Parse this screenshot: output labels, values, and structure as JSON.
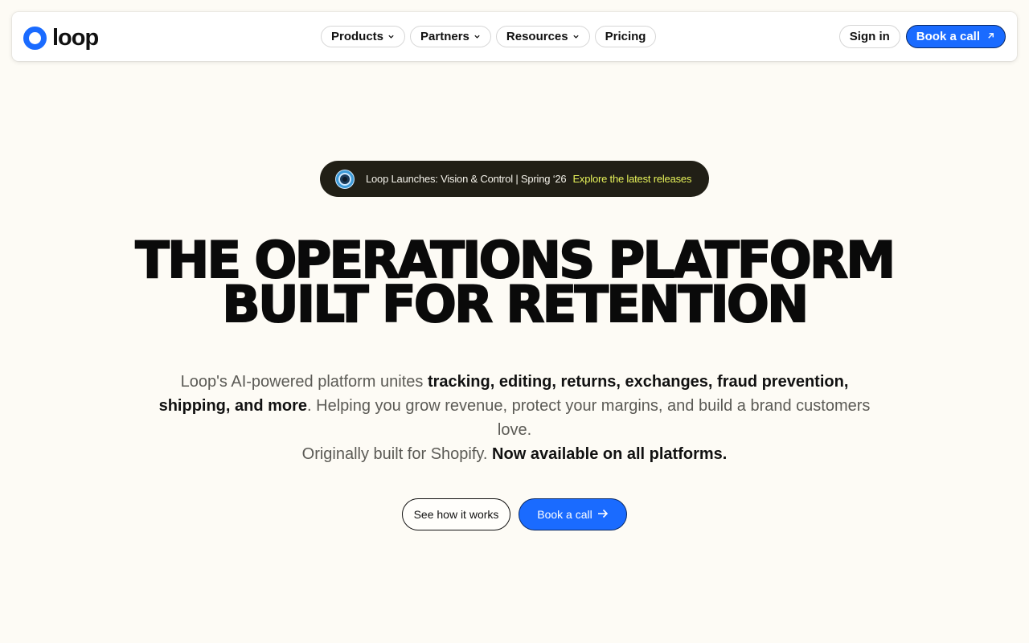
{
  "brand": {
    "name": "loop",
    "accent": "#1a6bff"
  },
  "nav": {
    "items": [
      {
        "label": "Products",
        "dropdown": true
      },
      {
        "label": "Partners",
        "dropdown": true
      },
      {
        "label": "Resources",
        "dropdown": true
      },
      {
        "label": "Pricing",
        "dropdown": false
      }
    ],
    "sign_in": "Sign in",
    "book_call": "Book a call"
  },
  "announcement": {
    "text": "Loop Launches: Vision & Control | Spring ‘26",
    "link": "Explore the latest releases"
  },
  "hero": {
    "headline_line1": "THE OPERATIONS PLATFORM",
    "headline_line2": "BUILT FOR RETENTION",
    "sub_part1": "Loop's AI-powered platform unites ",
    "sub_bold1": "tracking, editing, returns, exchanges, fraud prevention, shipping, and more",
    "sub_part2": ". Helping you grow revenue, protect your margins, and build a brand customers love.",
    "sub2_part1": "Originally built for Shopify. ",
    "sub2_bold": "Now available on all platforms.",
    "cta_secondary": "See how it works",
    "cta_primary": "Book a call"
  },
  "icons": {
    "logo": "loop-ring-logo",
    "dropdown": "chevron-down-icon",
    "external": "arrow-up-right-icon",
    "cta_arrow": "arrow-right-icon",
    "announcement": "vision-ring-icon"
  }
}
